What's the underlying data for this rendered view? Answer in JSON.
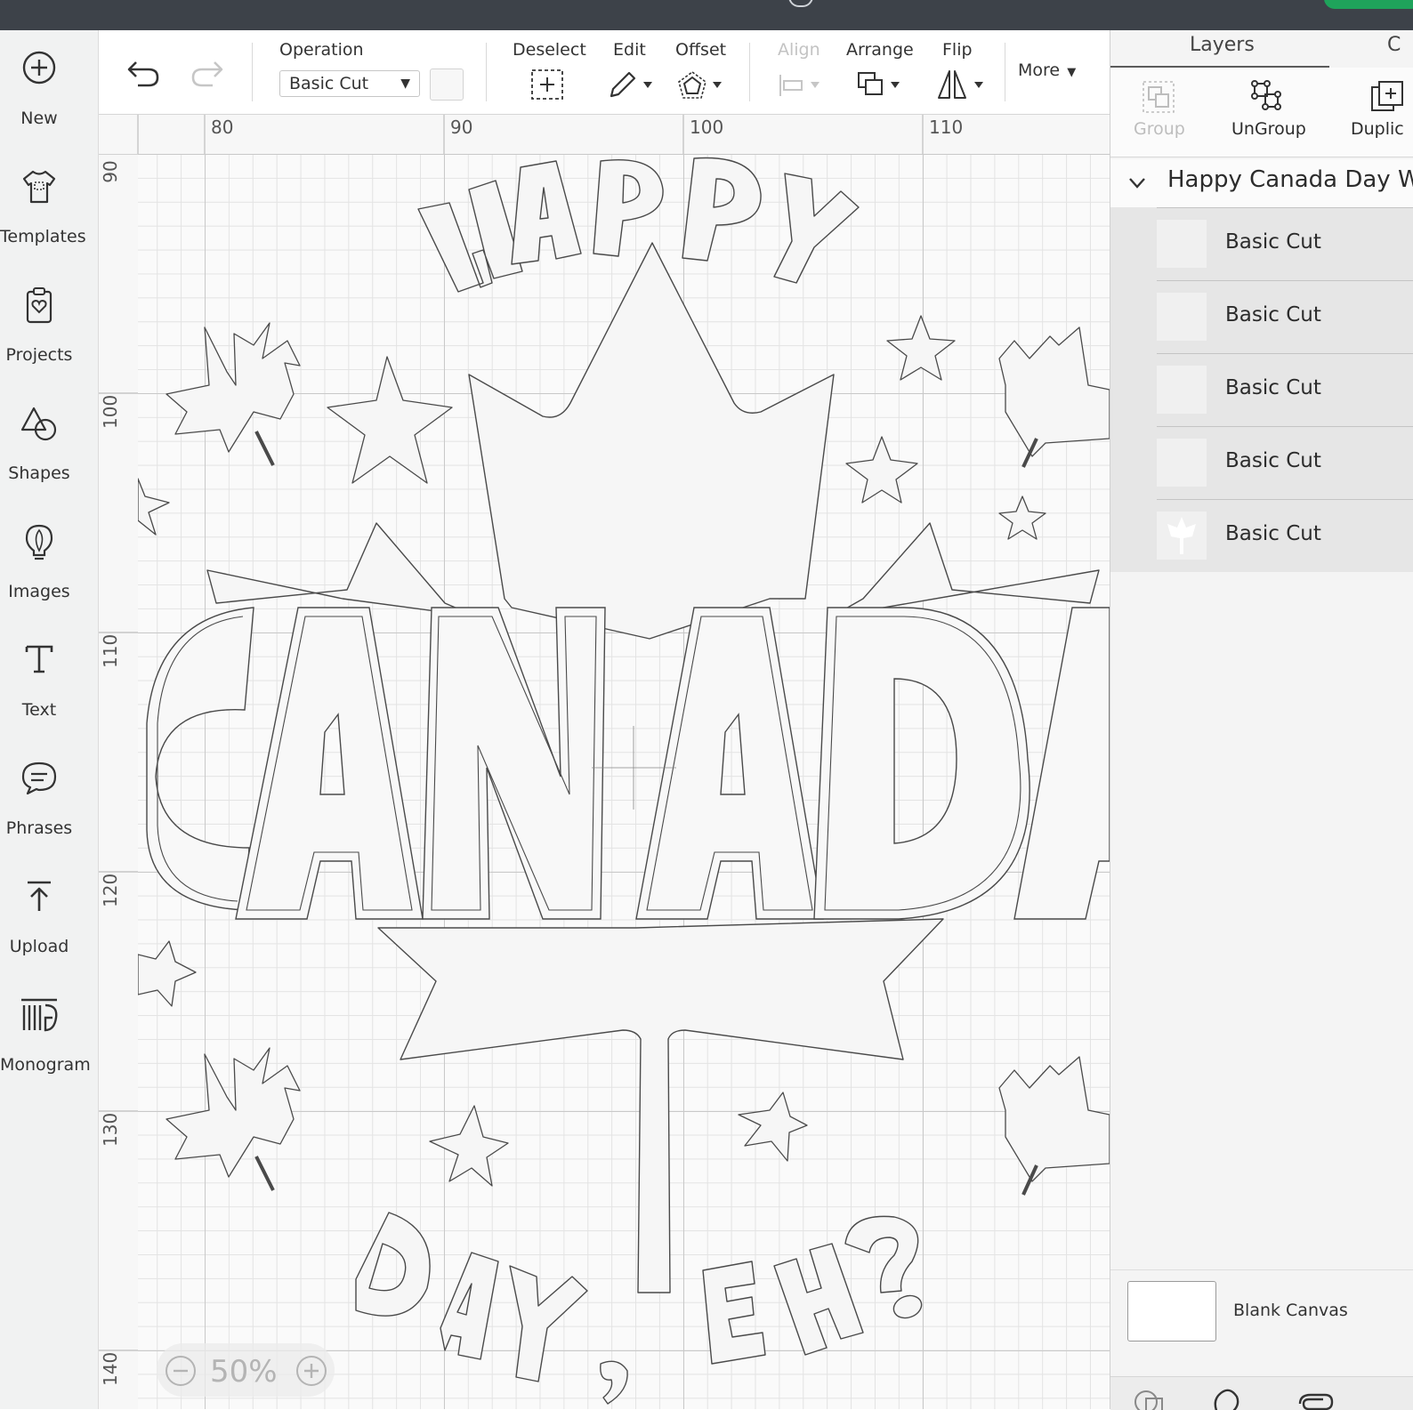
{
  "left_nav": {
    "items": [
      {
        "label": "New",
        "icon": "plus-circle-icon"
      },
      {
        "label": "Templates",
        "icon": "tshirt-icon"
      },
      {
        "label": "Projects",
        "icon": "clipboard-heart-icon"
      },
      {
        "label": "Shapes",
        "icon": "shapes-icon"
      },
      {
        "label": "Images",
        "icon": "lightbulb-icon"
      },
      {
        "label": "Text",
        "icon": "text-t-icon"
      },
      {
        "label": "Phrases",
        "icon": "speech-bubble-icon"
      },
      {
        "label": "Upload",
        "icon": "upload-arrow-icon"
      },
      {
        "label": "Monogram",
        "icon": "monogram-icon"
      }
    ]
  },
  "toolbar": {
    "operation_label": "Operation",
    "operation_value": "Basic Cut",
    "deselect_label": "Deselect",
    "edit_label": "Edit",
    "offset_label": "Offset",
    "align_label": "Align",
    "arrange_label": "Arrange",
    "flip_label": "Flip",
    "more_label": "More"
  },
  "rulers": {
    "top": [
      "80",
      "90",
      "100",
      "110"
    ],
    "left": [
      "90",
      "100",
      "110",
      "120",
      "130",
      "140"
    ]
  },
  "canvas": {
    "zoom_level": "50%",
    "design_words": {
      "top": "HAPPY",
      "middle": "CANADA",
      "bottom": "DAY, EH?"
    }
  },
  "layers_panel": {
    "tabs": [
      "Layers",
      "C"
    ],
    "actions": {
      "group": "Group",
      "ungroup": "UnGroup",
      "duplicate": "Duplic"
    },
    "group_title": "Happy Canada Day W",
    "layers": [
      {
        "label": "Basic Cut"
      },
      {
        "label": "Basic Cut"
      },
      {
        "label": "Basic Cut"
      },
      {
        "label": "Basic Cut"
      },
      {
        "label": "Basic Cut"
      }
    ],
    "blank_canvas_label": "Blank Canvas"
  },
  "colors": {
    "topbar": "#3d4249",
    "accent_green": "#1fa35b",
    "panel_bg": "#f4f4f4",
    "layer_row_bg": "#e6e6e6"
  }
}
